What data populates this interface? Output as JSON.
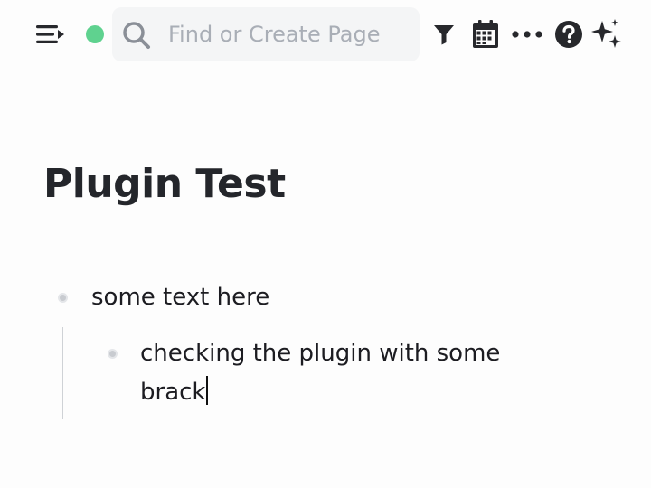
{
  "topbar": {
    "search": {
      "placeholder": "Find or Create Page",
      "value": ""
    },
    "status_color": "#5fd28f",
    "icons": [
      "menu-toggle-icon",
      "search-icon",
      "filter-icon",
      "calendar-icon",
      "more-icon",
      "help-icon",
      "sparkles-icon"
    ]
  },
  "page": {
    "title": "Plugin Test",
    "blocks": [
      {
        "text": "some text here",
        "level": 0
      },
      {
        "text": "checking the plugin with some brack",
        "level": 1,
        "editing": true
      }
    ]
  }
}
